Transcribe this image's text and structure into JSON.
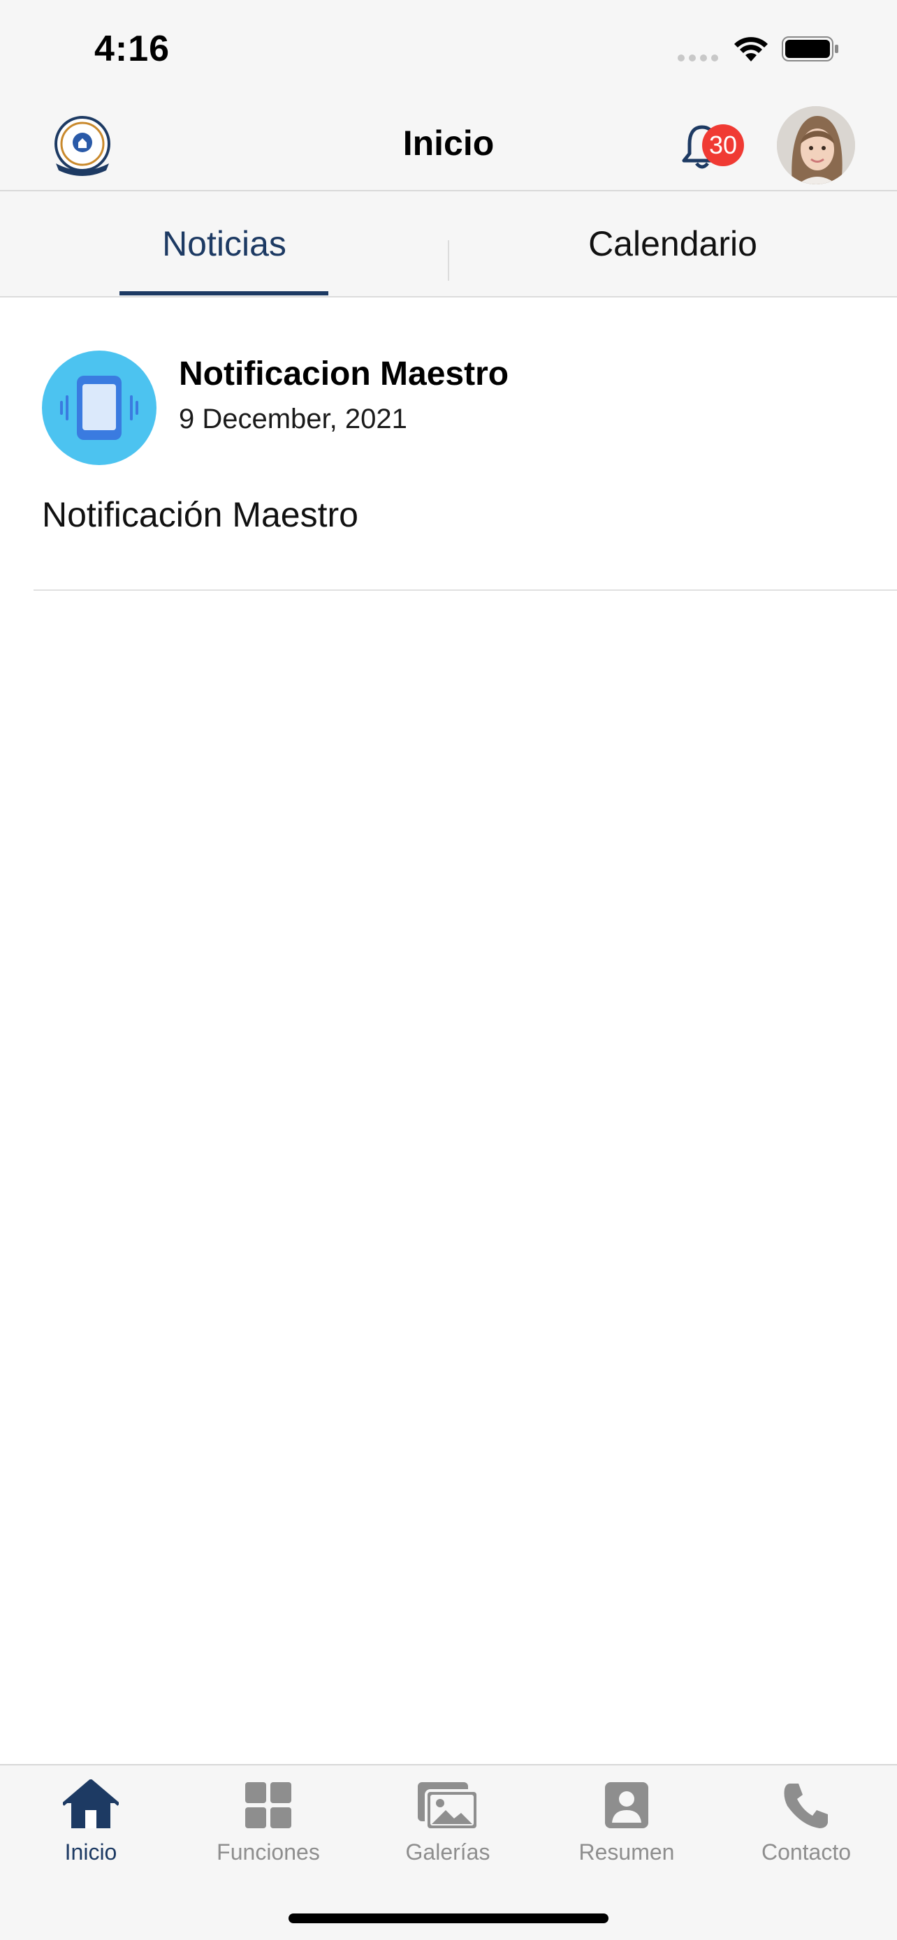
{
  "status": {
    "time": "4:16"
  },
  "nav": {
    "title": "Inicio",
    "badge_count": "30"
  },
  "tabs": [
    {
      "label": "Noticias",
      "active": true
    },
    {
      "label": "Calendario",
      "active": false
    }
  ],
  "news": [
    {
      "title": "Notificacion Maestro",
      "date": "9 December, 2021",
      "body": "Notificación Maestro",
      "icon": "phone-vibrate-icon"
    }
  ],
  "tab_bar": [
    {
      "label": "Inicio",
      "icon": "home-icon",
      "active": true
    },
    {
      "label": "Funciones",
      "icon": "grid-icon",
      "active": false
    },
    {
      "label": "Galerías",
      "icon": "gallery-icon",
      "active": false
    },
    {
      "label": "Resumen",
      "icon": "profile-card-icon",
      "active": false
    },
    {
      "label": "Contacto",
      "icon": "phone-icon",
      "active": false
    }
  ],
  "colors": {
    "accent": "#1d3a63",
    "badge": "#f03a33",
    "inactive": "#8e8e8e"
  }
}
